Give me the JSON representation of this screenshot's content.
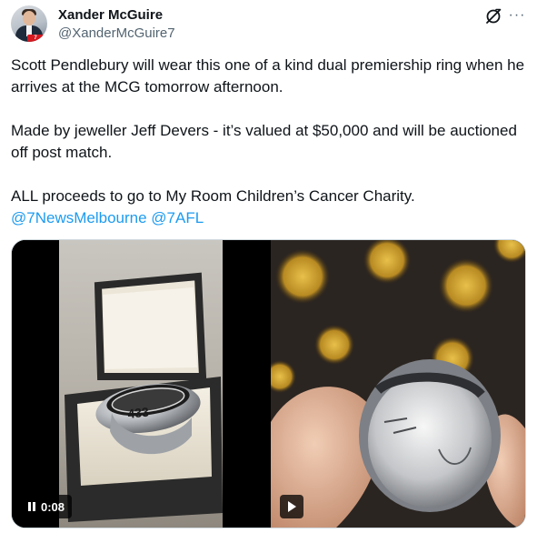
{
  "author": {
    "display_name": "Xander McGuire",
    "handle": "@XanderMcGuire7",
    "avatar_icon": "profile-photo",
    "badge_text": "7"
  },
  "header_icons": {
    "grok": "grok-icon",
    "more": "more-icon",
    "more_glyph": "···"
  },
  "tweet": {
    "paragraph_1": "Scott Pendlebury will wear this one of a kind dual premiership ring when he arrives at the MCG tomorrow afternoon.",
    "paragraph_2": "Made by jeweller Jeff Devers - it’s valued at $50,000 and will be auctioned off post match.",
    "paragraph_3": "ALL proceeds to go to My Room Children’s Cancer Charity.",
    "mention_1": "@7NewsMelbourne",
    "mention_2": "@7AFL"
  },
  "media": {
    "video_1": {
      "duration": "0:08",
      "control_icon": "pause-icon",
      "ring_number": "433"
    },
    "video_2": {
      "control_icon": "play-icon"
    }
  },
  "colors": {
    "accent": "#1d9bf0",
    "text_primary": "#0f1419",
    "text_secondary": "#536471",
    "border": "#cfd9de"
  }
}
